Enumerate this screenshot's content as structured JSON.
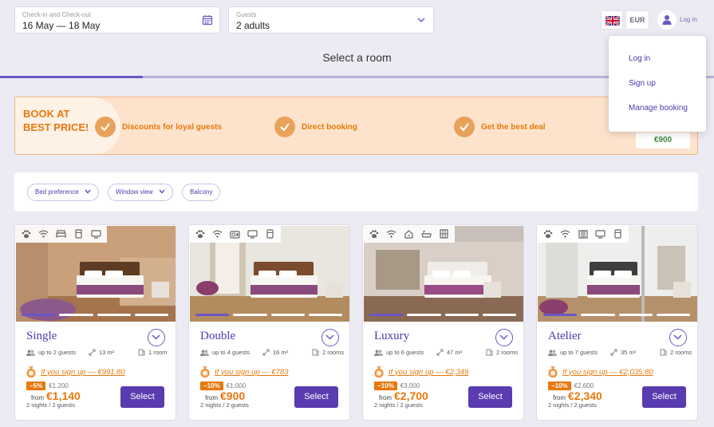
{
  "search": {
    "dates_label": "Check-in and Check-out",
    "dates_value": "16 May — 18 May",
    "guests_label": "Guests",
    "guests_value": "2 adults"
  },
  "header": {
    "currency": "EUR",
    "login_label": "Log in",
    "dropdown": [
      "Log in",
      "Sign up",
      "Manage booking"
    ]
  },
  "page_title": "Select a room",
  "progress": 0.2,
  "banner": {
    "headline": "BOOK AT BEST PRICE!",
    "perks": [
      "Discounts for loyal guests",
      "Direct booking",
      "Get the best deal"
    ],
    "price": "€900"
  },
  "filters": [
    "Bed preference",
    "Window view",
    "Balcony"
  ],
  "colors": {
    "accent": "#5a3bb0",
    "orange": "#e8780c"
  },
  "rooms": [
    {
      "name": "Single",
      "guests": "up to 2 guests",
      "area": "13 m²",
      "rooms": "1 room",
      "promo": "If you sign up — €991.80",
      "discount": "−5%",
      "old_price": "€1,200",
      "from": "from",
      "price": "€1,140",
      "nights": "2 nights / 2 guests",
      "select": "Select",
      "amenities": [
        "pet-icon",
        "wifi-icon",
        "bed-icon",
        "fridge-icon",
        "tv-icon"
      ]
    },
    {
      "name": "Double",
      "guests": "up to 4 guests",
      "area": "16 m²",
      "rooms": "2 rooms",
      "promo": "If you sign up — €783",
      "discount": "−10%",
      "old_price": "€1,000",
      "from": "from",
      "price": "€900",
      "nights": "2 nights / 2 guests",
      "select": "Select",
      "amenities": [
        "pet-icon",
        "wifi-icon",
        "coffee-icon",
        "tv-icon",
        "fridge-icon"
      ]
    },
    {
      "name": "Luxury",
      "guests": "up to 6 guests",
      "area": "47 m²",
      "rooms": "2 rooms",
      "promo": "If you sign up — €2,349",
      "discount": "−10%",
      "old_price": "€3,000",
      "from": "from",
      "price": "€2,700",
      "nights": "2 nights / 2 guests",
      "select": "Select",
      "amenities": [
        "pet-icon",
        "wifi-icon",
        "kettle-icon",
        "bath-icon",
        "safe-icon"
      ]
    },
    {
      "name": "Atelier",
      "guests": "up to 7 guests",
      "area": "35 m²",
      "rooms": "2 rooms",
      "promo": "If you sign up — €2,035.80",
      "discount": "−10%",
      "old_price": "€2,600",
      "from": "from",
      "price": "€2,340",
      "nights": "2 nights / 2 guests",
      "select": "Select",
      "amenities": [
        "pet-icon",
        "wifi-icon",
        "heater-icon",
        "tv-icon",
        "fridge-icon"
      ]
    }
  ]
}
